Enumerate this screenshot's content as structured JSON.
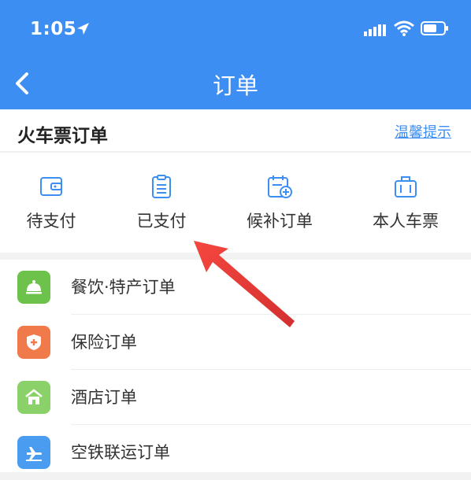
{
  "status_bar": {
    "time": "1:05"
  },
  "header": {
    "title": "订单"
  },
  "ticket_card": {
    "title": "火车票订单",
    "tip": "温馨提示",
    "tabs": [
      {
        "label": "待支付",
        "icon": "wallet-icon"
      },
      {
        "label": "已支付",
        "icon": "clipboard-icon"
      },
      {
        "label": "候补订单",
        "icon": "calendar-add-icon"
      },
      {
        "label": "本人车票",
        "icon": "luggage-icon"
      }
    ]
  },
  "order_list": [
    {
      "label": "餐饮·特产订单",
      "icon": "dining-bell-icon",
      "color": "#6cc24a"
    },
    {
      "label": "保险订单",
      "icon": "shield-icon",
      "color": "#f07a4a"
    },
    {
      "label": "酒店订单",
      "icon": "hotel-icon",
      "color": "#8bd16a"
    },
    {
      "label": "空铁联运订单",
      "icon": "plane-train-icon",
      "color": "#4a9cf0"
    }
  ],
  "colors": {
    "primary": "#3d8ef2",
    "arrow": "#e53935"
  }
}
